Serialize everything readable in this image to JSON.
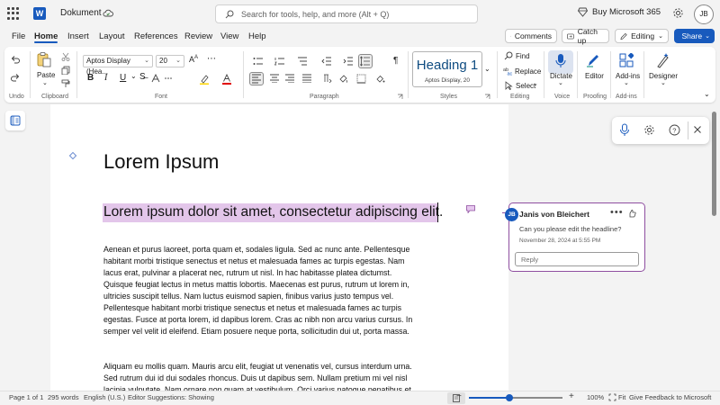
{
  "titlebar": {
    "app_icon": "word-icon",
    "app_letter": "W",
    "doc_title": "Dokument",
    "search_placeholder": "Search for tools, help, and more (Alt + Q)",
    "buy_label": "Buy Microsoft 365",
    "avatar_initials": "JB"
  },
  "menu": {
    "tabs": [
      "File",
      "Home",
      "Insert",
      "Layout",
      "References",
      "Review",
      "View",
      "Help"
    ],
    "active_tab": "Home",
    "comments_label": "Comments",
    "catchup_label": "Catch up",
    "editing_label": "Editing",
    "share_label": "Share"
  },
  "ribbon": {
    "undo_label": "Undo",
    "paste_label": "Paste",
    "clipboard_label": "Clipboard",
    "font_name": "Aptos Display (Hea...",
    "font_size": "20",
    "font_label": "Font",
    "bold": "B",
    "italic": "I",
    "underline": "U",
    "paragraph_label": "Paragraph",
    "style_name": "Heading 1",
    "style_sub": "Aptos Display, 20",
    "styles_label": "Styles",
    "find_label": "Find",
    "replace_label": "Replace",
    "select_label": "Select",
    "editing_group_label": "Editing",
    "dictate_label": "Dictate",
    "voice_label": "Voice",
    "editor_label": "Editor",
    "proofing_label": "Proofing",
    "addins_label": "Add-ins",
    "addins_group_label": "Add-ins",
    "designer_label": "Designer"
  },
  "document": {
    "title": "Lorem Ipsum",
    "headline": "Lorem ipsum dolor sit amet, consectetur adipiscing elit.",
    "paragraph1": [
      "Aenean et purus laoreet, porta quam et, sodales ligula. Sed ac nunc ante. Pellentesque",
      "habitant morbi tristique senectus et netus et malesuada fames ac turpis egestas. Nam",
      "lacus erat, pulvinar a placerat nec, rutrum ut nisl. In hac habitasse platea dictumst.",
      "Quisque feugiat lectus in metus mattis lobortis. Maecenas est purus, rutrum ut lorem in,",
      "ultricies suscipit tellus. Nam luctus euismod sapien, finibus varius justo tempus vel.",
      "Pellentesque habitant morbi tristique senectus et netus et malesuada fames ac turpis",
      "egestas. Fusce at porta lorem, id dapibus lorem. Cras ac nibh non arcu varius cursus. In",
      "semper vel velit id eleifend. Etiam posuere neque porta, sollicitudin dui ut, porta massa."
    ],
    "paragraph2": [
      "Aliquam eu mollis quam. Mauris arcu elit, feugiat ut venenatis vel, cursus interdum urna.",
      "Sed rutrum dui id dui sodales rhoncus. Duis ut dapibus sem. Nullam pretium mi vel nisl",
      "lacinia vulputate. Nam ornare non quam at vestibulum. Orci varius natoque penatibus et"
    ]
  },
  "comment": {
    "initials": "JB",
    "author": "Janis von Bleichert",
    "text": "Can you please edit the headline?",
    "timestamp": "November 28, 2024 at 5:55 PM",
    "reply_placeholder": "Reply"
  },
  "statusbar": {
    "page": "Page 1 of 1",
    "words": "295 words",
    "language": "English (U.S.)",
    "suggestions": "Editor Suggestions: Showing",
    "zoom_minus": "−",
    "zoom_plus": "+",
    "zoom": "100%",
    "fit": "Fit",
    "feedback": "Give Feedback to Microsoft",
    "zoom_fraction": 0.43
  },
  "colors": {
    "accent": "#185abd",
    "highlight": "#e3c6ea",
    "comment_border": "#8e4ea0"
  }
}
